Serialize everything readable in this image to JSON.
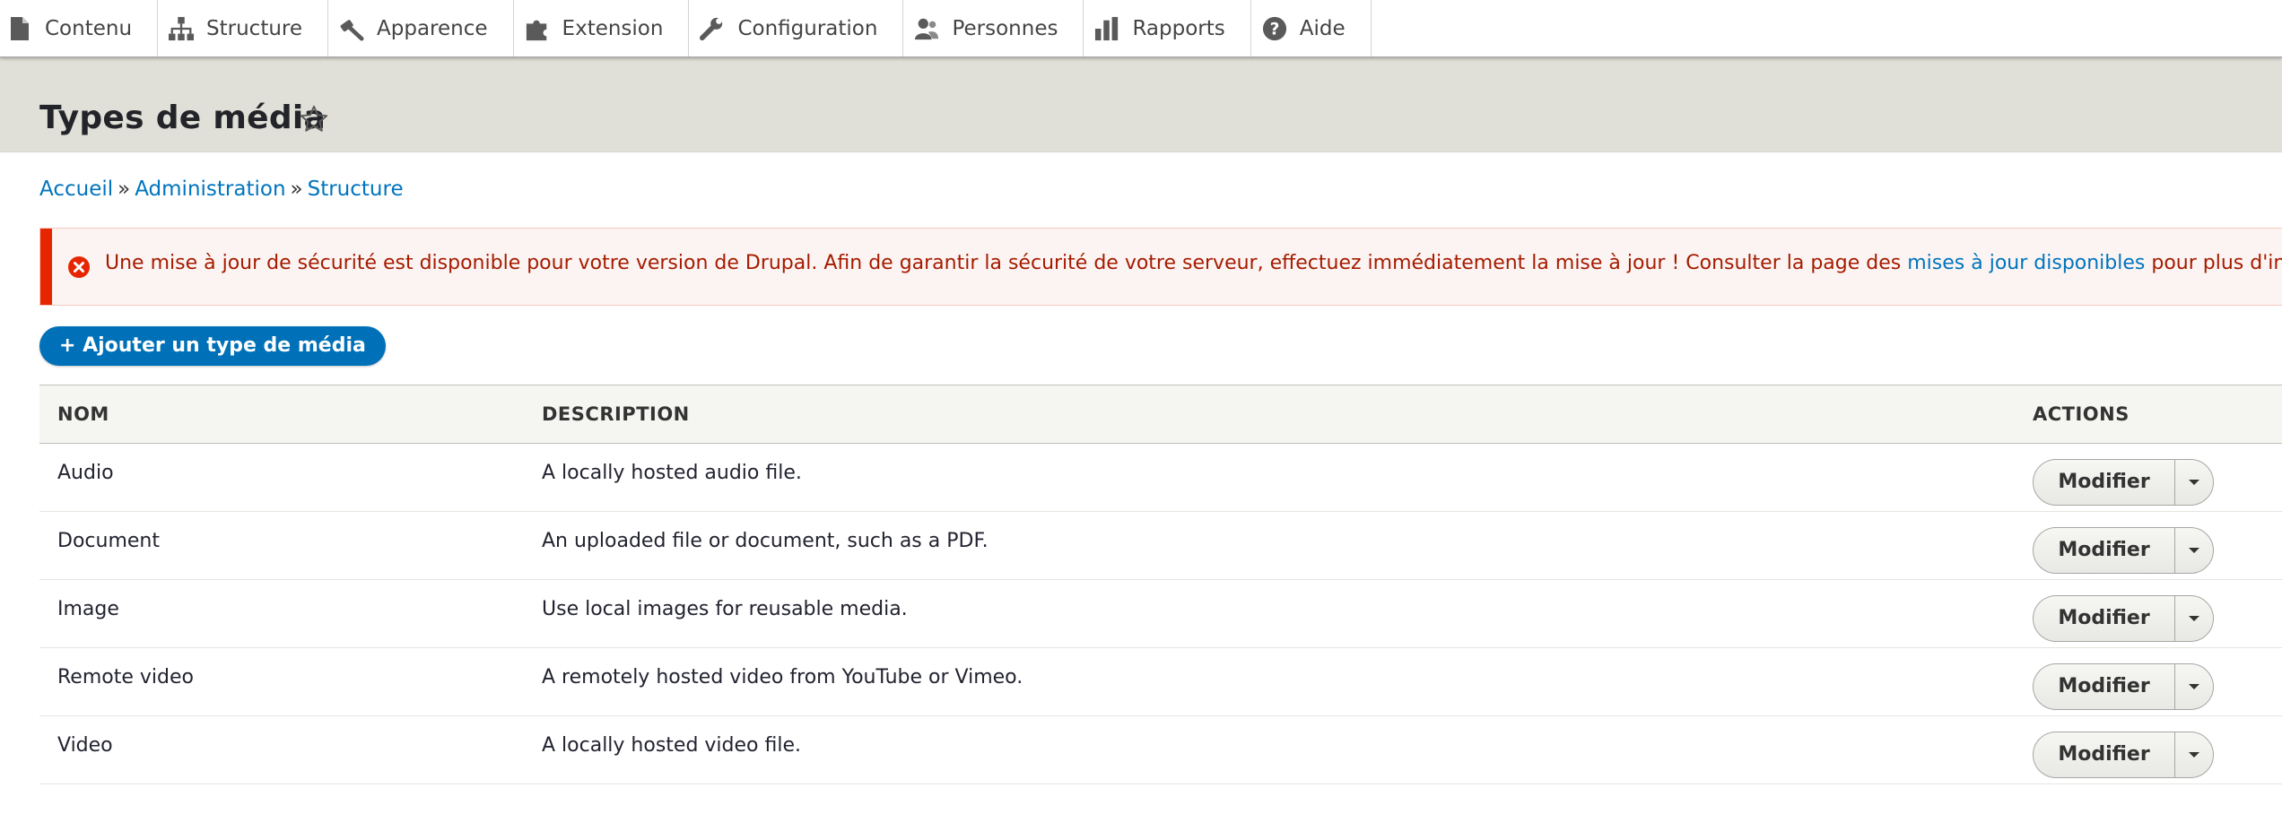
{
  "toolbar": {
    "items": [
      {
        "label": "Contenu",
        "icon": "file-icon"
      },
      {
        "label": "Structure",
        "icon": "sitemap-icon"
      },
      {
        "label": "Apparence",
        "icon": "paintbrush-icon"
      },
      {
        "label": "Extension",
        "icon": "puzzle-icon"
      },
      {
        "label": "Configuration",
        "icon": "wrench-icon"
      },
      {
        "label": "Personnes",
        "icon": "people-icon"
      },
      {
        "label": "Rapports",
        "icon": "bar-chart-icon"
      },
      {
        "label": "Aide",
        "icon": "help-icon"
      }
    ]
  },
  "page": {
    "title": "Types de média"
  },
  "breadcrumb": {
    "items": [
      "Accueil",
      "Administration",
      "Structure"
    ],
    "separator": "»"
  },
  "message": {
    "type": "error",
    "text": "Une mise à jour de sécurité est disponible pour votre version de Drupal. Afin de garantir la sécurité de votre serveur, effectuez immédiatement la mise à jour ! Consulter la page des",
    "link": "mises à jour disponibles",
    "suffix": "pour plus d'informations"
  },
  "actions": {
    "add_label": "+ Ajouter un type de média"
  },
  "table": {
    "headers": {
      "name": "NOM",
      "description": "DESCRIPTION",
      "actions": "ACTIONS"
    },
    "rows": [
      {
        "name": "Audio",
        "description": "A locally hosted audio file.",
        "action": "Modifier"
      },
      {
        "name": "Document",
        "description": "An uploaded file or document, such as a PDF.",
        "action": "Modifier"
      },
      {
        "name": "Image",
        "description": "Use local images for reusable media.",
        "action": "Modifier"
      },
      {
        "name": "Remote video",
        "description": "A remotely hosted video from YouTube or Vimeo.",
        "action": "Modifier"
      },
      {
        "name": "Video",
        "description": "A locally hosted video file.",
        "action": "Modifier"
      }
    ]
  },
  "colors": {
    "link": "#0074bd",
    "primary_button": "#0071b8",
    "error_text": "#a51b00",
    "error_bar": "#e62600",
    "header_band": "#e0e0d8"
  }
}
